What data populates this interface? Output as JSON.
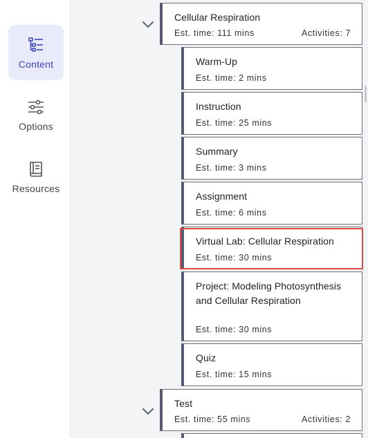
{
  "sidebar": {
    "items": [
      {
        "label": "Content",
        "icon": "content-list-icon",
        "active": true
      },
      {
        "label": "Options",
        "icon": "sliders-icon",
        "active": false
      },
      {
        "label": "Resources",
        "icon": "book-icon",
        "active": false
      }
    ]
  },
  "units": [
    {
      "title": "Cellular Respiration",
      "est_time": "Est. time: 111 mins",
      "activities": "Activities: 7",
      "expanded": true,
      "items": [
        {
          "title": "Warm-Up",
          "est_time": "Est. time: 2 mins"
        },
        {
          "title": "Instruction",
          "est_time": "Est. time: 25 mins"
        },
        {
          "title": "Summary",
          "est_time": "Est. time: 3 mins"
        },
        {
          "title": "Assignment",
          "est_time": "Est. time: 6 mins"
        },
        {
          "title": "Virtual Lab: Cellular Respiration",
          "est_time": "Est. time: 30 mins",
          "highlighted": true
        },
        {
          "title": "Project: Modeling Photosynthesis and Cellular Respiration",
          "est_time": "Est. time: 30 mins"
        },
        {
          "title": "Quiz",
          "est_time": "Est. time: 15 mins"
        }
      ]
    },
    {
      "title": "Test",
      "est_time": "Est. time: 55 mins",
      "activities": "Activities: 2",
      "expanded": true
    }
  ],
  "colors": {
    "accent": "#3e44b5",
    "active_bg": "#e9ebfb",
    "card_left_bar": "#555a72",
    "highlight": "#e04a45"
  }
}
